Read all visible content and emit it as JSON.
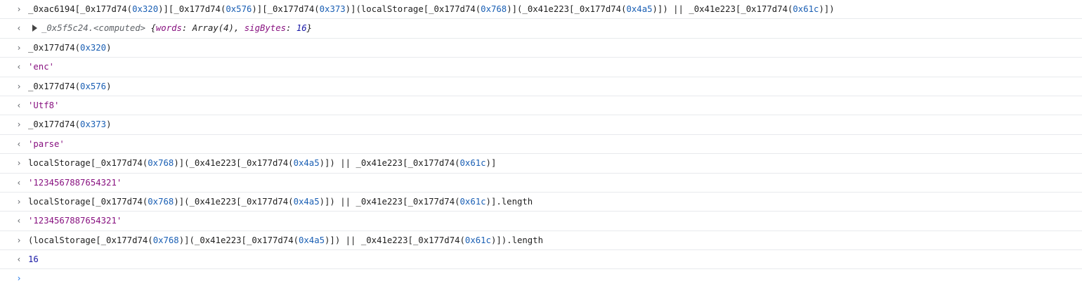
{
  "console": {
    "input_glyph": "›",
    "output_glyph": "‹",
    "entries": [
      {
        "kind": "input",
        "tokens": [
          {
            "t": "_0xac6194[_0x177d74("
          },
          {
            "t": "0x320",
            "c": "hex"
          },
          {
            "t": ")][_0x177d74("
          },
          {
            "t": "0x576",
            "c": "hex"
          },
          {
            "t": ")][_0x177d74("
          },
          {
            "t": "0x373",
            "c": "hex"
          },
          {
            "t": ")](localStorage[_0x177d74("
          },
          {
            "t": "0x768",
            "c": "hex"
          },
          {
            "t": ")](_0x41e223[_0x177d74("
          },
          {
            "t": "0x4a5",
            "c": "hex"
          },
          {
            "t": ")]) || _0x41e223[_0x177d74("
          },
          {
            "t": "0x61c",
            "c": "hex"
          },
          {
            "t": ")])"
          }
        ]
      },
      {
        "kind": "object",
        "name": "_0x5f5c24.<computed>",
        "preview_open": "{",
        "props": [
          {
            "key": "words",
            "sep": ": ",
            "value": "Array(4)",
            "vc": ""
          },
          {
            "key": "sigBytes",
            "sep": ": ",
            "value": "16",
            "vc": "prop-num"
          }
        ],
        "preview_close": "}"
      },
      {
        "kind": "input",
        "tokens": [
          {
            "t": "_0x177d74("
          },
          {
            "t": "0x320",
            "c": "hex"
          },
          {
            "t": ")"
          }
        ]
      },
      {
        "kind": "output",
        "tokens": [
          {
            "t": "'enc'",
            "c": "str"
          }
        ]
      },
      {
        "kind": "input",
        "tokens": [
          {
            "t": "_0x177d74("
          },
          {
            "t": "0x576",
            "c": "hex"
          },
          {
            "t": ")"
          }
        ]
      },
      {
        "kind": "output",
        "tokens": [
          {
            "t": "'Utf8'",
            "c": "str"
          }
        ]
      },
      {
        "kind": "input",
        "tokens": [
          {
            "t": "_0x177d74("
          },
          {
            "t": "0x373",
            "c": "hex"
          },
          {
            "t": ")"
          }
        ]
      },
      {
        "kind": "output",
        "tokens": [
          {
            "t": "'parse'",
            "c": "str"
          }
        ]
      },
      {
        "kind": "input",
        "tokens": [
          {
            "t": "localStorage[_0x177d74("
          },
          {
            "t": "0x768",
            "c": "hex"
          },
          {
            "t": ")](_0x41e223[_0x177d74("
          },
          {
            "t": "0x4a5",
            "c": "hex"
          },
          {
            "t": ")]) || _0x41e223[_0x177d74("
          },
          {
            "t": "0x61c",
            "c": "hex"
          },
          {
            "t": ")]"
          }
        ]
      },
      {
        "kind": "output",
        "tokens": [
          {
            "t": "'1234567887654321'",
            "c": "str"
          }
        ]
      },
      {
        "kind": "input",
        "tokens": [
          {
            "t": "localStorage[_0x177d74("
          },
          {
            "t": "0x768",
            "c": "hex"
          },
          {
            "t": ")](_0x41e223[_0x177d74("
          },
          {
            "t": "0x4a5",
            "c": "hex"
          },
          {
            "t": ")]) || _0x41e223[_0x177d74("
          },
          {
            "t": "0x61c",
            "c": "hex"
          },
          {
            "t": ")].length"
          }
        ]
      },
      {
        "kind": "output",
        "tokens": [
          {
            "t": "'1234567887654321'",
            "c": "str"
          }
        ]
      },
      {
        "kind": "input",
        "tokens": [
          {
            "t": "(localStorage[_0x177d74("
          },
          {
            "t": "0x768",
            "c": "hex"
          },
          {
            "t": ")](_0x41e223[_0x177d74("
          },
          {
            "t": "0x4a5",
            "c": "hex"
          },
          {
            "t": ")]) || _0x41e223[_0x177d74("
          },
          {
            "t": "0x61c",
            "c": "hex"
          },
          {
            "t": ")]).length"
          }
        ]
      },
      {
        "kind": "output",
        "tokens": [
          {
            "t": "16",
            "c": "num"
          }
        ]
      }
    ],
    "prompt": {
      "value": ""
    }
  },
  "colors": {
    "hex": "#1a5fb4",
    "string": "#881280",
    "number": "#1a1aa6",
    "prompt_active": "#1a73e8",
    "row_border": "#e8eaed"
  }
}
